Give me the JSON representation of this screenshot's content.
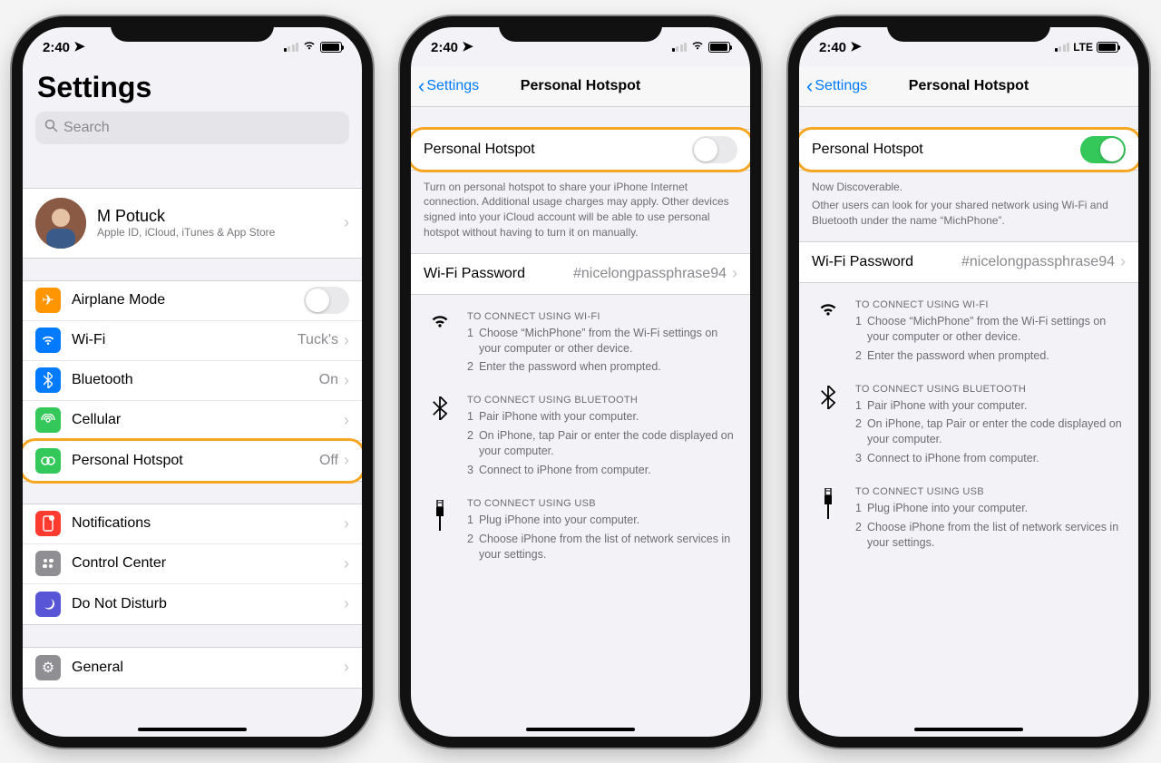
{
  "status": {
    "time": "2:40",
    "lte_label": "LTE"
  },
  "highlight_color": "#f5a623",
  "screen1": {
    "title": "Settings",
    "search_placeholder": "Search",
    "profile": {
      "name": "M Potuck",
      "sub": "Apple ID, iCloud, iTunes & App Store"
    },
    "rows_a": [
      {
        "icon": "airplane",
        "label": "Airplane Mode",
        "toggle": false
      },
      {
        "icon": "wifi",
        "label": "Wi-Fi",
        "value": "Tuck's"
      },
      {
        "icon": "bluetooth",
        "label": "Bluetooth",
        "value": "On"
      },
      {
        "icon": "cellular",
        "label": "Cellular",
        "value": ""
      },
      {
        "icon": "hotspot",
        "label": "Personal Hotspot",
        "value": "Off",
        "highlight": true
      }
    ],
    "rows_b": [
      {
        "icon": "notif",
        "label": "Notifications"
      },
      {
        "icon": "cc",
        "label": "Control Center"
      },
      {
        "icon": "dnd",
        "label": "Do Not Disturb"
      }
    ],
    "rows_c": [
      {
        "icon": "general",
        "label": "General"
      }
    ]
  },
  "screen2": {
    "back": "Settings",
    "title": "Personal Hotspot",
    "toggle_label": "Personal Hotspot",
    "toggle_on": false,
    "hint": "Turn on personal hotspot to share your iPhone Internet connection. Additional usage charges may apply. Other devices signed into your iCloud account will be able to use personal hotspot without having to turn it on manually.",
    "password_label": "Wi-Fi Password",
    "password_value": "#nicelongpassphrase94",
    "connect_wifi": {
      "title": "TO CONNECT USING WI-FI",
      "steps": [
        "Choose “MichPhone” from the Wi-Fi settings on your computer or other device.",
        "Enter the password when prompted."
      ]
    },
    "connect_bt": {
      "title": "TO CONNECT USING BLUETOOTH",
      "steps": [
        "Pair iPhone with your computer.",
        "On iPhone, tap Pair or enter the code displayed on your computer.",
        "Connect to iPhone from computer."
      ]
    },
    "connect_usb": {
      "title": "TO CONNECT USING USB",
      "steps": [
        "Plug iPhone into your computer.",
        "Choose iPhone from the list of network services in your settings."
      ]
    }
  },
  "screen3": {
    "back": "Settings",
    "title": "Personal Hotspot",
    "toggle_label": "Personal Hotspot",
    "toggle_on": true,
    "hint_line1": "Now Discoverable.",
    "hint_line2": "Other users can look for your shared network using Wi-Fi and Bluetooth under the name “MichPhone”.",
    "password_label": "Wi-Fi Password",
    "password_value": "#nicelongpassphrase94",
    "connect_wifi": {
      "title": "TO CONNECT USING WI-FI",
      "steps": [
        "Choose “MichPhone” from the Wi-Fi settings on your computer or other device.",
        "Enter the password when prompted."
      ]
    },
    "connect_bt": {
      "title": "TO CONNECT USING BLUETOOTH",
      "steps": [
        "Pair iPhone with your computer.",
        "On iPhone, tap Pair or enter the code displayed on your computer.",
        "Connect to iPhone from computer."
      ]
    },
    "connect_usb": {
      "title": "TO CONNECT USING USB",
      "steps": [
        "Plug iPhone into your computer.",
        "Choose iPhone from the list of network services in your settings."
      ]
    }
  }
}
